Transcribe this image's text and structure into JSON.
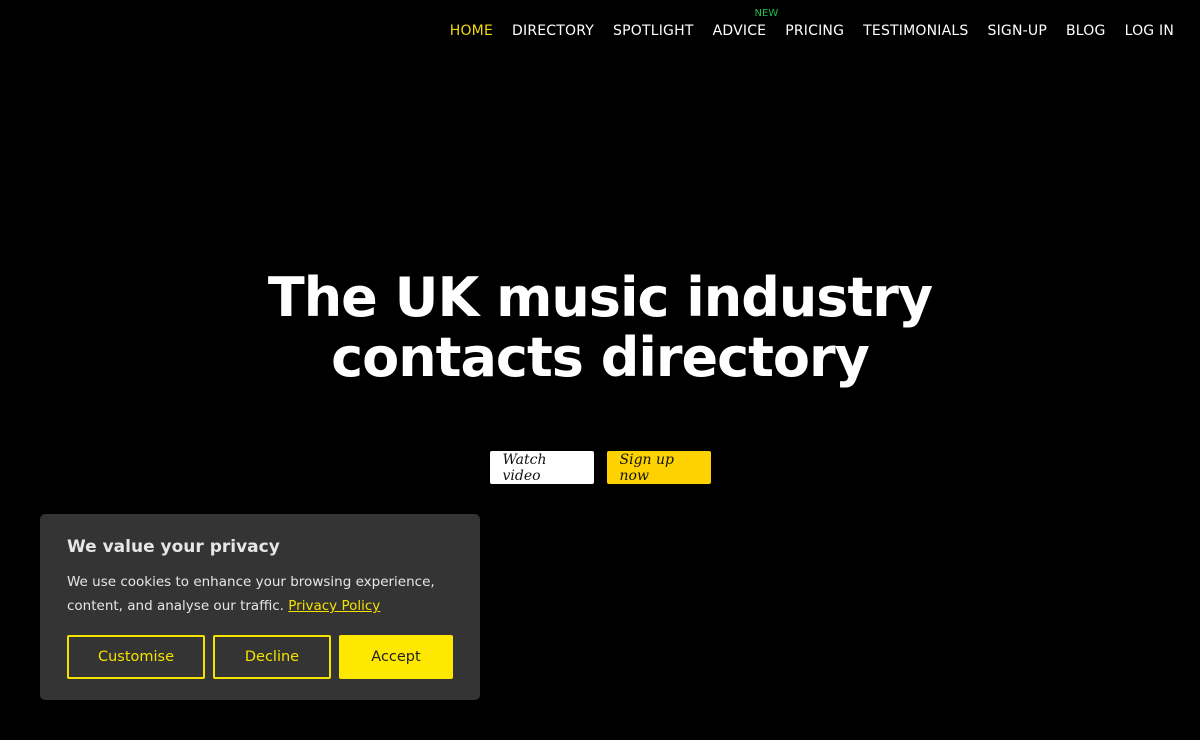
{
  "nav": {
    "items": [
      {
        "label": "HOME",
        "active": true
      },
      {
        "label": "DIRECTORY"
      },
      {
        "label": "SPOTLIGHT"
      },
      {
        "label": "ADVICE",
        "badge": "NEW"
      },
      {
        "label": "PRICING"
      },
      {
        "label": "TESTIMONIALS"
      },
      {
        "label": "SIGN-UP"
      },
      {
        "label": "BLOG"
      },
      {
        "label": "LOG IN"
      }
    ]
  },
  "hero": {
    "title_line1": "The UK music industry",
    "title_line2": "contacts directory",
    "watch_label": "Watch video",
    "signup_label": "Sign up now"
  },
  "cookie": {
    "title": "We value your privacy",
    "text": "We use cookies to enhance your browsing experience, content, and analyse our traffic.",
    "link": "Privacy Policy",
    "customise_label": "Customise",
    "decline_label": "Decline",
    "accept_label": "Accept"
  },
  "colors": {
    "background": "#000000",
    "accent": "#fdd200",
    "nav_active": "#f5d90a",
    "badge": "#1dbf4a",
    "cookie_bg": "#343434"
  }
}
